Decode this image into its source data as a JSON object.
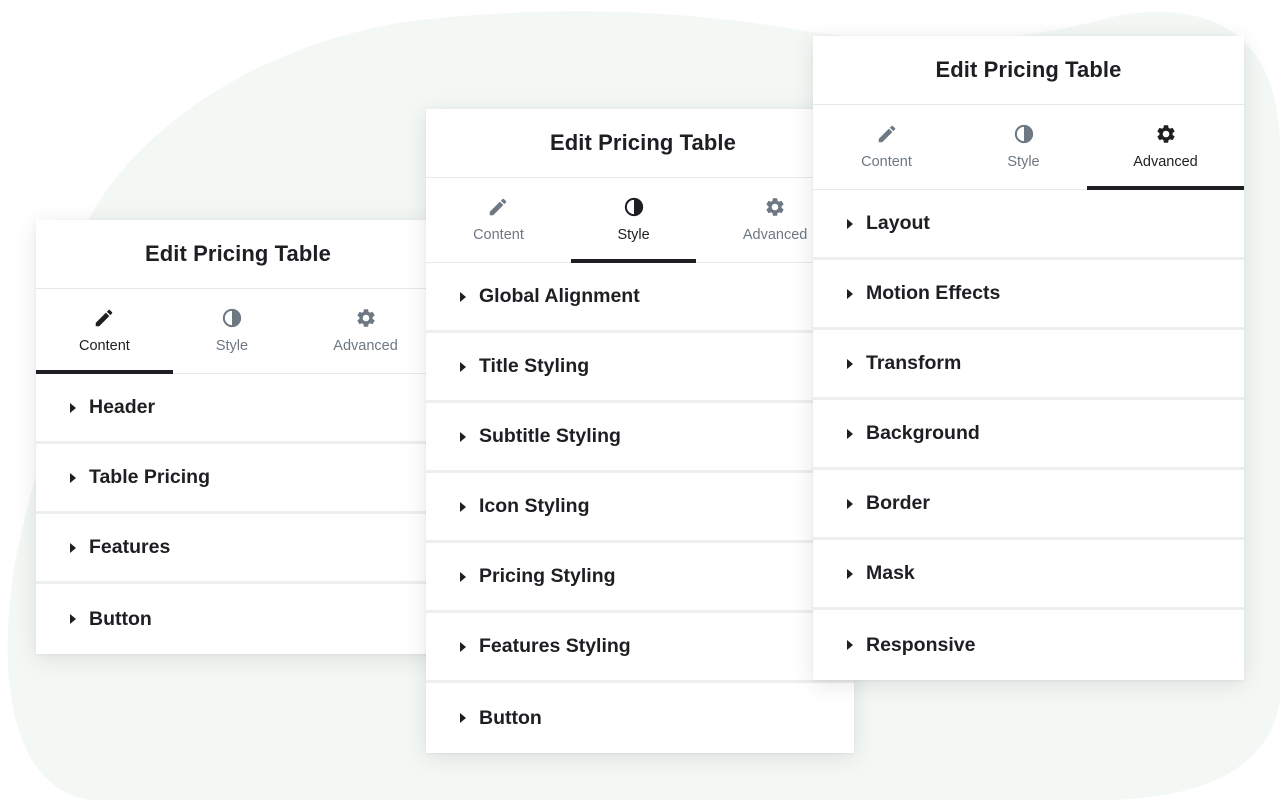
{
  "colors": {
    "background": "#ffffff",
    "blob": "#f3f8f5",
    "text_dark": "#1d1f22",
    "text_muted": "#6d7882",
    "divider": "#eceef0"
  },
  "panels": [
    {
      "title": "Edit Pricing Table",
      "active_tab": "Content",
      "tabs": [
        {
          "label": "Content",
          "icon": "pencil-icon"
        },
        {
          "label": "Style",
          "icon": "half-circle-icon"
        },
        {
          "label": "Advanced",
          "icon": "gear-icon"
        }
      ],
      "sections": [
        "Header",
        "Table Pricing",
        "Features",
        "Button"
      ]
    },
    {
      "title": "Edit Pricing Table",
      "active_tab": "Style",
      "tabs": [
        {
          "label": "Content",
          "icon": "pencil-icon"
        },
        {
          "label": "Style",
          "icon": "half-circle-icon"
        },
        {
          "label": "Advanced",
          "icon": "gear-icon"
        }
      ],
      "sections": [
        "Global Alignment",
        "Title Styling",
        "Subtitle Styling",
        "Icon Styling",
        "Pricing Styling",
        "Features Styling",
        "Button"
      ]
    },
    {
      "title": "Edit Pricing Table",
      "active_tab": "Advanced",
      "tabs": [
        {
          "label": "Content",
          "icon": "pencil-icon"
        },
        {
          "label": "Style",
          "icon": "half-circle-icon"
        },
        {
          "label": "Advanced",
          "icon": "gear-icon"
        }
      ],
      "sections": [
        "Layout",
        "Motion Effects",
        "Transform",
        "Background",
        "Border",
        "Mask",
        "Responsive"
      ]
    }
  ]
}
